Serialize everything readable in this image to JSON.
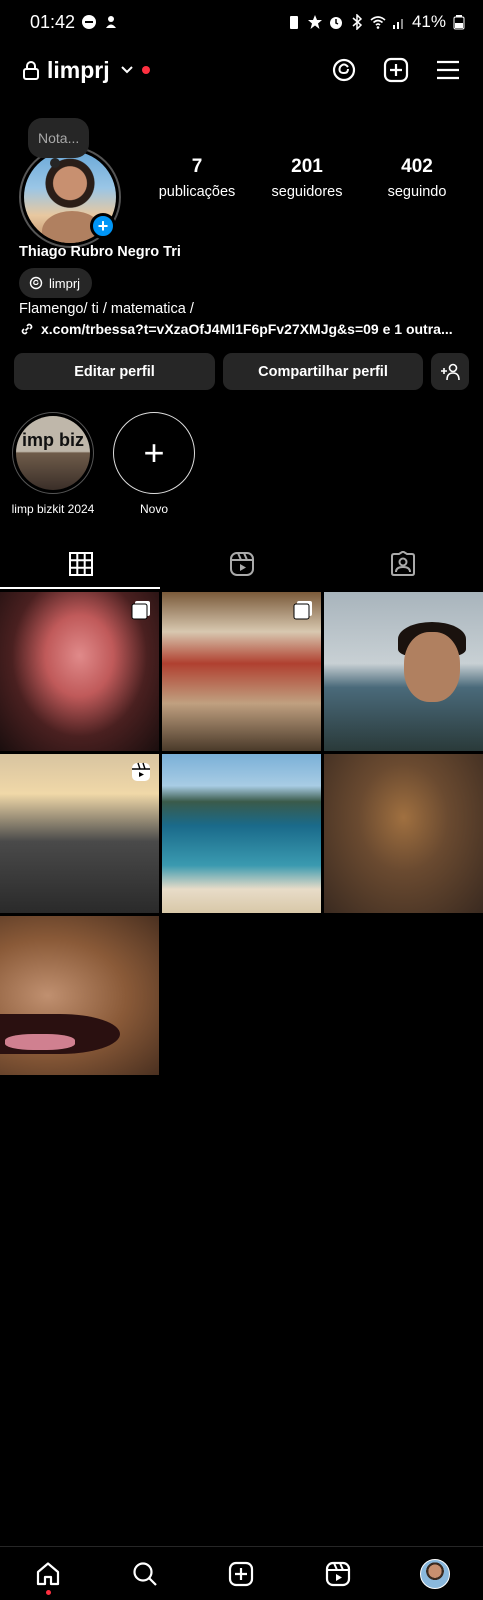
{
  "status_bar": {
    "time": "01:42",
    "battery": "41%"
  },
  "header": {
    "username": "limprj"
  },
  "profile": {
    "note": "Nota...",
    "stats": [
      {
        "value": "7",
        "label": "publicações"
      },
      {
        "value": "201",
        "label": "seguidores"
      },
      {
        "value": "402",
        "label": "seguindo"
      }
    ],
    "full_name": "Thiago Rubro Negro Tri",
    "threads_handle": "limprj",
    "bio": "Flamengo/ ti / matematica /",
    "link": "x.com/trbessa?t=vXzaOfJ4Ml1F6pFv27XMJg&s=09 e 1 outra..."
  },
  "buttons": {
    "edit": "Editar perfil",
    "share": "Compartilhar perfil"
  },
  "highlights": [
    {
      "label": "limp bizkit 2024",
      "cover_text": "imp biz"
    },
    {
      "label": "Novo",
      "symbol": "+"
    }
  ],
  "tabs": [
    "grid-icon",
    "reels-icon",
    "tagged-icon"
  ],
  "posts": [
    {
      "id": "concert-stage",
      "type": "carousel"
    },
    {
      "id": "group-friends",
      "type": "carousel"
    },
    {
      "id": "selfie-beach",
      "type": "photo"
    },
    {
      "id": "street-sunset",
      "type": "reel"
    },
    {
      "id": "beach-aerial",
      "type": "photo"
    },
    {
      "id": "dog-sleeping",
      "type": "photo"
    },
    {
      "id": "dog-closeup",
      "type": "photo"
    }
  ],
  "bottom_nav": [
    "home-icon",
    "search-icon",
    "create-icon",
    "reels-icon",
    "profile-avatar"
  ]
}
